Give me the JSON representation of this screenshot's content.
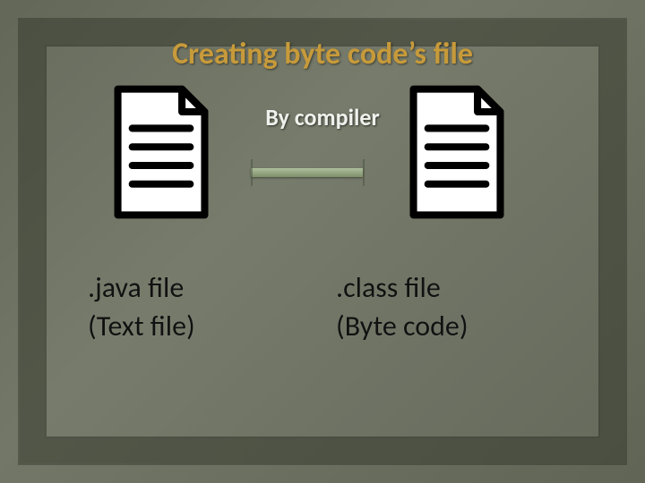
{
  "title": "Creating byte code’s file",
  "process_caption": "By compiler",
  "left_file": {
    "name_line": ".java file",
    "desc_line": "(Text file)",
    "icon": "document-icon"
  },
  "right_file": {
    "name_line": ".class file",
    "desc_line": "(Byte code)",
    "icon": "document-icon"
  },
  "arrow": {
    "icon": "arrow-right-icon"
  },
  "colors": {
    "title": "#c79a3a",
    "caption": "#f0f0ec",
    "arrow": "#8a9c78",
    "background": "#6b705f"
  }
}
